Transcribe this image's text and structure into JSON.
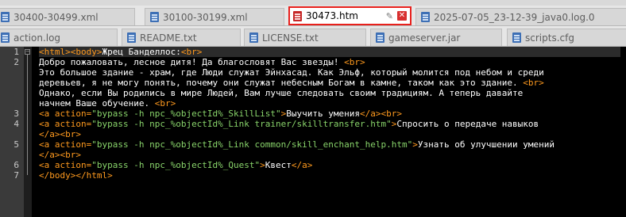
{
  "tabs_row1": [
    {
      "label": "30400-30499.xml",
      "active": false
    },
    {
      "label": "30100-30199.xml",
      "active": false
    },
    {
      "label": "30473.htm",
      "active": true
    },
    {
      "label": "2025-07-05_23-12-39_java0.log.0",
      "active": false
    }
  ],
  "tabs_row2": [
    {
      "label": "action.log"
    },
    {
      "label": "README.txt"
    },
    {
      "label": "LICENSE.txt"
    },
    {
      "label": "gameserver.jar"
    },
    {
      "label": "scripts.cfg"
    }
  ],
  "gutter": {
    "line_numbers": [
      "1",
      "2",
      "3",
      "4",
      "5",
      "6",
      "7",
      "8",
      "9"
    ]
  },
  "code": {
    "lines": [
      [
        [
          "tag",
          "<html><body>"
        ],
        [
          "txt",
          "Жрец Банделлос:"
        ],
        [
          "tag",
          "<br>"
        ]
      ],
      [
        [
          "txt",
          "Добро пожаловать, лесное дитя! Да благословят Вас звезды! "
        ],
        [
          "tag",
          "<br>"
        ]
      ],
      [
        [
          "txt",
          "Это большое здание - храм, где Люди служат Эйнхасад. Как Эльф, который молится под небом и среди"
        ]
      ],
      [
        [
          "txt",
          "деревьев, я не могу понять, почему они служат небесным Богам в камне, таком как это здание. "
        ],
        [
          "tag",
          "<br>"
        ]
      ],
      [
        [
          "txt",
          "Однако, если Вы родились в мире Людей, Вам лучше следовать своим традициям. А теперь давайте"
        ]
      ],
      [
        [
          "txt",
          "начнем Ваше обучение. "
        ],
        [
          "tag",
          "<br>"
        ]
      ],
      [
        [
          "tag",
          "<a action="
        ],
        [
          "str",
          "\"bypass -h npc_%objectId%_SkillList\""
        ],
        [
          "tag",
          ">"
        ],
        [
          "txt",
          "Выучить умения"
        ],
        [
          "tag",
          "</a><br>"
        ]
      ],
      [
        [
          "tag",
          "<a action="
        ],
        [
          "str",
          "\"bypass -h npc_%objectId%_Link trainer/skilltransfer.htm\""
        ],
        [
          "tag",
          ">"
        ],
        [
          "txt",
          "Спросить о передаче навыков"
        ]
      ],
      [
        [
          "tag",
          "</a><br>"
        ]
      ],
      [
        [
          "tag",
          "<a action="
        ],
        [
          "str",
          "\"bypass -h npc_%objectId%_Link common/skill_enchant_help.htm\""
        ],
        [
          "tag",
          ">"
        ],
        [
          "txt",
          "Узнать об улучшении умений"
        ]
      ],
      [
        [
          "tag",
          "</a><br>"
        ]
      ],
      [
        [
          "tag",
          "<a action="
        ],
        [
          "str",
          "\"bypass -h npc_%objectId%_Quest\""
        ],
        [
          "tag",
          ">"
        ],
        [
          "txt",
          "Квест"
        ],
        [
          "tag",
          "</a>"
        ]
      ],
      [
        [
          "tag",
          "</body></html>"
        ]
      ]
    ],
    "line_number_rows": [
      0,
      1,
      6,
      7,
      9,
      11,
      12
    ]
  },
  "colors": {
    "active_tab_border": "#e8201c",
    "tag": "#ff9a1e",
    "string": "#88d36a",
    "text": "#ffffff",
    "background": "#000000"
  }
}
